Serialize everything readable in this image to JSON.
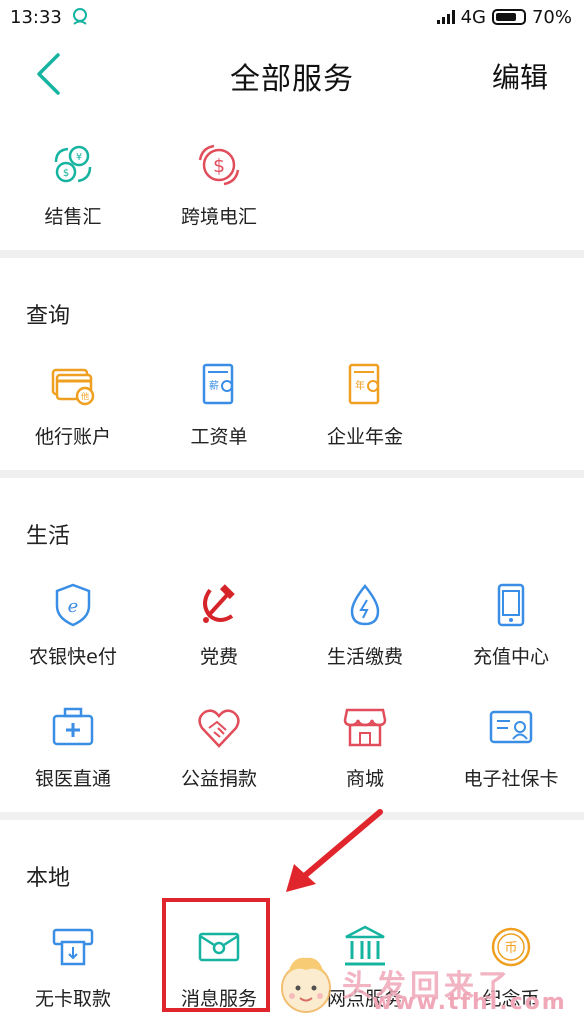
{
  "status_bar": {
    "time": "13:33",
    "network": "4G",
    "battery": "70%"
  },
  "header": {
    "title": "全部服务",
    "edit_label": "编辑"
  },
  "colors": {
    "teal": "#16b4a0",
    "red": "#e14d5a",
    "orange": "#f0a020",
    "blue": "#3a8ee6",
    "highlight": "#e0262c"
  },
  "sections": {
    "top": {
      "items": [
        {
          "label": "结售汇",
          "icon": "currency-exchange-icon"
        },
        {
          "label": "跨境电汇",
          "icon": "dollar-transfer-icon"
        }
      ]
    },
    "query": {
      "title": "查询",
      "items": [
        {
          "label": "他行账户",
          "icon": "cards-icon"
        },
        {
          "label": "工资单",
          "icon": "salary-slip-icon"
        },
        {
          "label": "企业年金",
          "icon": "annuity-icon"
        }
      ]
    },
    "life": {
      "title": "生活",
      "items": [
        {
          "label": "农银快e付",
          "icon": "e-pay-shield-icon"
        },
        {
          "label": "党费",
          "icon": "hammer-sickle-icon"
        },
        {
          "label": "生活缴费",
          "icon": "water-drop-icon"
        },
        {
          "label": "充值中心",
          "icon": "mobile-phone-icon"
        },
        {
          "label": "银医直通",
          "icon": "medical-kit-icon"
        },
        {
          "label": "公益捐款",
          "icon": "handshake-heart-icon"
        },
        {
          "label": "商城",
          "icon": "shop-icon"
        },
        {
          "label": "电子社保卡",
          "icon": "id-card-icon"
        }
      ]
    },
    "local": {
      "title": "本地",
      "items": [
        {
          "label": "无卡取款",
          "icon": "atm-icon"
        },
        {
          "label": "消息服务",
          "icon": "message-envelope-icon"
        },
        {
          "label": "网点服务",
          "icon": "bank-branch-icon"
        },
        {
          "label": "纪念币",
          "icon": "coin-icon"
        }
      ]
    }
  },
  "watermark": {
    "text": "头发回来了",
    "sub": "www.tfhl.com"
  }
}
